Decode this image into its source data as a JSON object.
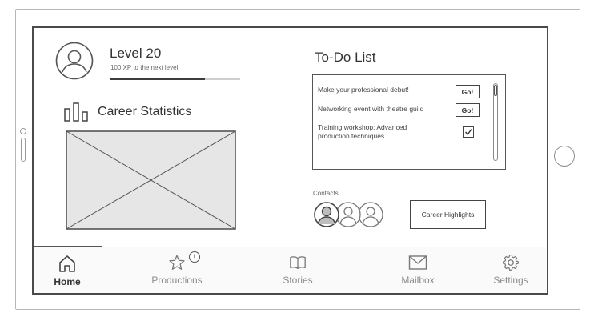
{
  "player": {
    "level_title": "Level 20",
    "xp_subtitle": "100 XP to the next level",
    "xp_progress": 0.73
  },
  "career_stats": {
    "title": "Career Statistics"
  },
  "todo": {
    "title": "To-Do List",
    "items": [
      {
        "text_lines": [
          "Make your professional debut!"
        ],
        "action": "Go!"
      },
      {
        "text_lines": [
          "Networking event with theatre guild"
        ],
        "action": "Go!"
      },
      {
        "text_lines": [
          "Training workshop: Advanced",
          "production techniques"
        ],
        "completed": true
      }
    ]
  },
  "contacts": {
    "label": "Contacts",
    "count": 3
  },
  "career_highlights_button": "Career Highlights",
  "nav": {
    "active": "Home",
    "items": [
      {
        "label": "Home",
        "icon": "home-icon"
      },
      {
        "label": "Productions",
        "icon": "star-icon",
        "badge": "!"
      },
      {
        "label": "Stories",
        "icon": "book-icon"
      },
      {
        "label": "Mailbox",
        "icon": "mail-icon"
      },
      {
        "label": "Settings",
        "icon": "gear-icon"
      }
    ]
  },
  "colors": {
    "frame": "#4a4a4a",
    "text": "#333333",
    "muted": "#8a8a8a"
  }
}
